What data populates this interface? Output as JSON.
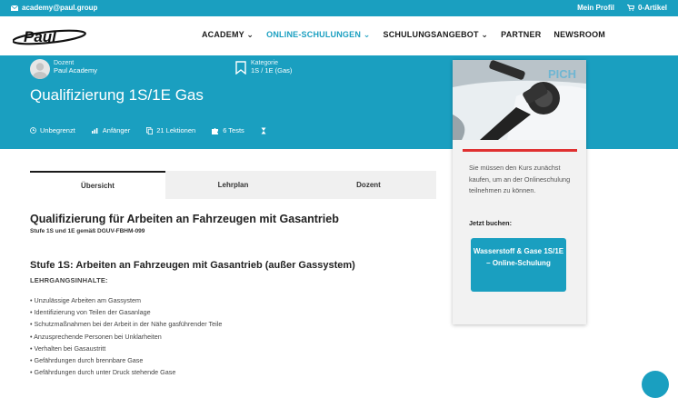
{
  "topbar": {
    "email": "academy@paul.group",
    "profile": "Mein Profil",
    "cart": "0-Artikel"
  },
  "nav": {
    "logo_text": "Paul",
    "items": [
      {
        "label": "ACADEMY",
        "chevron": true
      },
      {
        "label": "ONLINE-SCHULUNGEN",
        "chevron": true
      },
      {
        "label": "SCHULUNGSANGEBOT",
        "chevron": true
      },
      {
        "label": "PARTNER",
        "chevron": false
      },
      {
        "label": "NEWSROOM",
        "chevron": false
      }
    ]
  },
  "course": {
    "instructor_label": "Dozent",
    "instructor": "Paul Academy",
    "category_label": "Kategorie",
    "category": "1S / 1E (Gas)",
    "title": "Qualifizierung 1S/1E Gas",
    "infos": {
      "duration": "Unbegrenzt",
      "level": "Anfänger",
      "lessons": "21 Lektionen",
      "tests": "6 Tests"
    }
  },
  "tabs": [
    "Übersicht",
    "Lehrplan",
    "Dozent"
  ],
  "content": {
    "heading": "Qualifizierung für Arbeiten an Fahrzeugen mit Gasantrieb",
    "subheading": "Stufe 1S und 1E gemäß DGUV-FBHM-099",
    "stage_bold": "Stufe 1S",
    "stage_rest": ": Arbeiten an Fahrzeugen mit Gasantrieb (außer Gassystem)",
    "contents_label": "LEHRGANGSINHALTE:",
    "items": [
      "• Unzulässige Arbeiten am Gassystem",
      "• Identifizierung von Teilen der Gasanlage",
      "• Schutzmaßnahmen bei der Arbeit in der Nähe gasführender Teile",
      "• Anzusprechende Personen bei Unklarheiten",
      "• Verhalten bei Gasaustritt",
      "• Gefährdungen durch brennbare Gase",
      "• Gefährdungen durch unter Druck stehende Gase"
    ]
  },
  "sidebar": {
    "info": "Sie müssen den Kurs zunächst kaufen, um an der Onlineschulung teilnehmen zu können.",
    "buy_now": "Jetzt buchen:",
    "button": "Wasserstoff & Gase 1S/1E – Online-Schulung"
  },
  "colors": {
    "brand": "#1a9fc0",
    "accent_red": "#e03030"
  }
}
